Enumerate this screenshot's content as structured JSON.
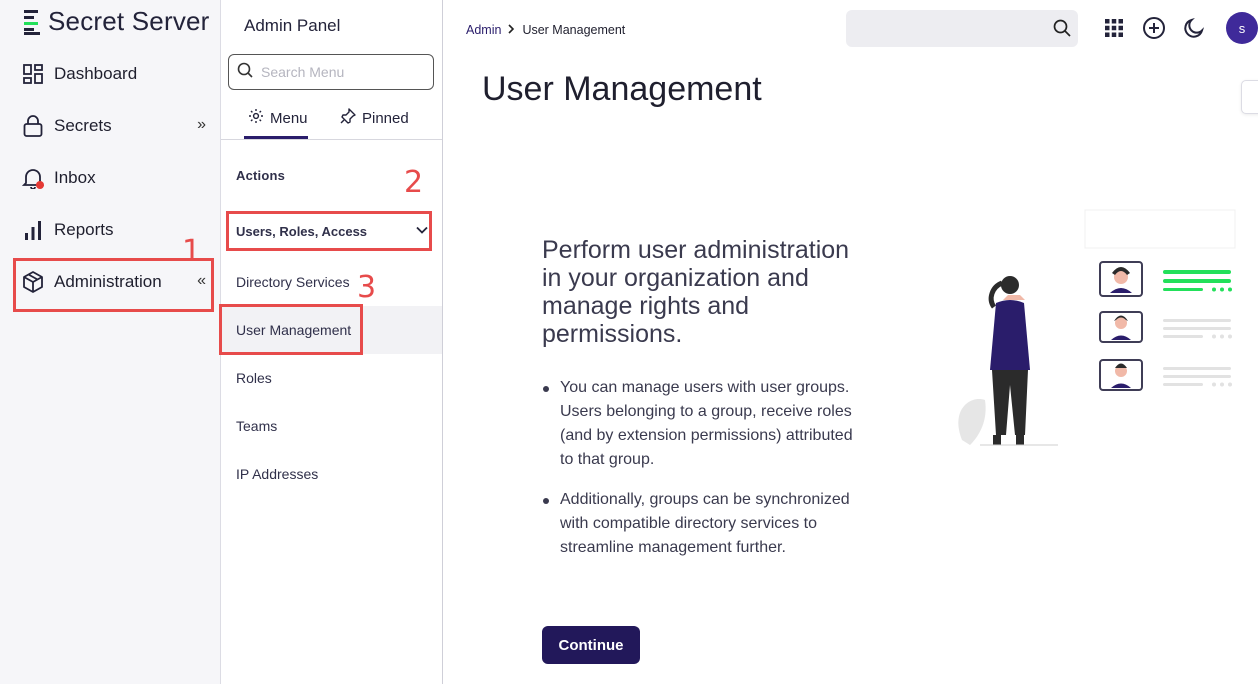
{
  "brand": {
    "name": "Secret Server"
  },
  "leftnav": {
    "items": [
      {
        "label": "Dashboard",
        "icon": "dashboard-icon"
      },
      {
        "label": "Secrets",
        "icon": "lock-icon",
        "chevron": "»"
      },
      {
        "label": "Inbox",
        "icon": "bell-icon"
      },
      {
        "label": "Reports",
        "icon": "bar-chart-icon"
      },
      {
        "label": "Administration",
        "icon": "cube-icon",
        "chevron": "«"
      }
    ]
  },
  "annotations": {
    "n1": "1",
    "n2": "2",
    "n3": "3",
    "color": "#e74b4b"
  },
  "panel": {
    "title": "Admin Panel",
    "search_placeholder": "Search Menu",
    "tabs": [
      {
        "label": "Menu"
      },
      {
        "label": "Pinned"
      }
    ],
    "section": "Actions",
    "group": "Users, Roles, Access",
    "items": [
      {
        "label": "Directory Services"
      },
      {
        "label": "User Management"
      },
      {
        "label": "Roles"
      },
      {
        "label": "Teams"
      },
      {
        "label": "IP Addresses"
      }
    ]
  },
  "topbar": {
    "breadcrumb": {
      "root": "Admin",
      "current": "User Management"
    },
    "search_value": "",
    "avatar_letter": "s"
  },
  "main": {
    "title": "User Management",
    "headline": "Perform user administration in your organization and manage rights and permissions.",
    "bullets": [
      "You can manage users with user groups. Users belonging to a group, receive roles (and by extension permissions) attributed to that group.",
      "Additionally, groups can be synchronized with compatible directory services to streamline management further."
    ],
    "continue_label": "Continue"
  },
  "colors": {
    "accent": "#22185a",
    "avatar": "#3f2a9a",
    "highlight_green": "#22e05a",
    "notification_dot": "#e53935"
  }
}
